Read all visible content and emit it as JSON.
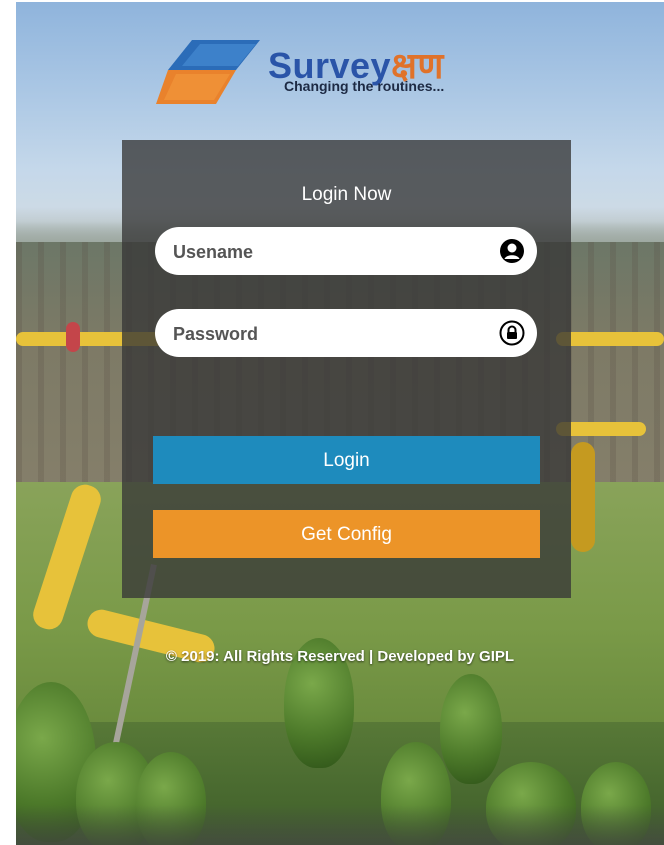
{
  "brand": {
    "name_latin": "Survey",
    "name_devanagari": "क्षण",
    "tagline": "Changing the routines..."
  },
  "login": {
    "title": "Login Now",
    "username_placeholder": "Usename",
    "password_placeholder": "Password",
    "login_label": "Login",
    "config_label": "Get Config"
  },
  "footer": {
    "text": "© 2019: All Rights Reserved | Developed by GIPL"
  },
  "icons": {
    "username": "user-circle-icon",
    "password": "lock-circle-icon"
  },
  "colors": {
    "brand_blue": "#2a54a8",
    "brand_orange": "#e0722a",
    "login_button": "#1e8bbd",
    "config_button": "#ec9428",
    "panel_overlay": "rgba(55,55,55,0.78)"
  }
}
